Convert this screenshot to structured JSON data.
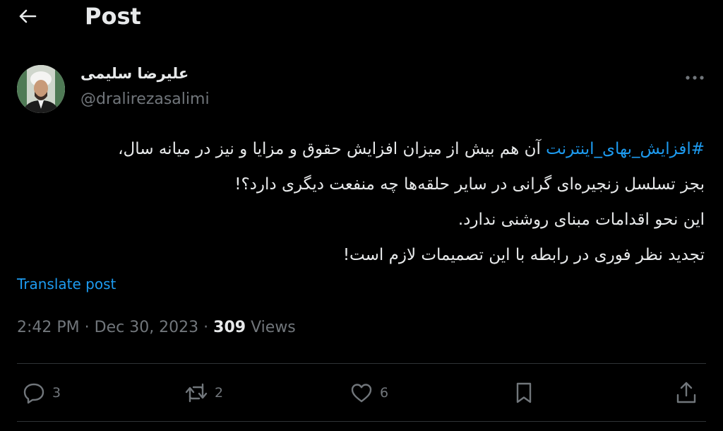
{
  "header": {
    "title": "Post"
  },
  "author": {
    "name": "علیرضا سلیمی",
    "handle": "@dralirezasalimi"
  },
  "tweet": {
    "hashtag": "#افزایش_بهای_اینترنت",
    "line1_rest": " آن هم بیش از میزان افزایش حقوق و مزایا و نیز در میانه سال،",
    "line2": "بجز تسلسل زنجیره‌ای گرانی در سایر حلقه‌ها چه منفعت دیگری دارد؟!",
    "line3": "این نحو اقدامات مبنای روشنی ندارد.",
    "line4": "تجدید نظر فوری در رابطه با این تصمیمات لازم است!"
  },
  "translate_label": "Translate post",
  "meta": {
    "time": "2:42 PM",
    "separator": " · ",
    "date": "Dec 30, 2023",
    "views_count": "309",
    "views_label": " Views"
  },
  "actions": {
    "replies": "3",
    "reposts": "2",
    "likes": "6"
  },
  "icons": [
    "back-arrow-icon",
    "more-icon",
    "reply-icon",
    "repost-icon",
    "like-icon",
    "bookmark-icon",
    "share-icon"
  ],
  "colors": {
    "background": "#000000",
    "text": "#e7e9ea",
    "secondary": "#71767b",
    "accent": "#1d9bf0"
  }
}
